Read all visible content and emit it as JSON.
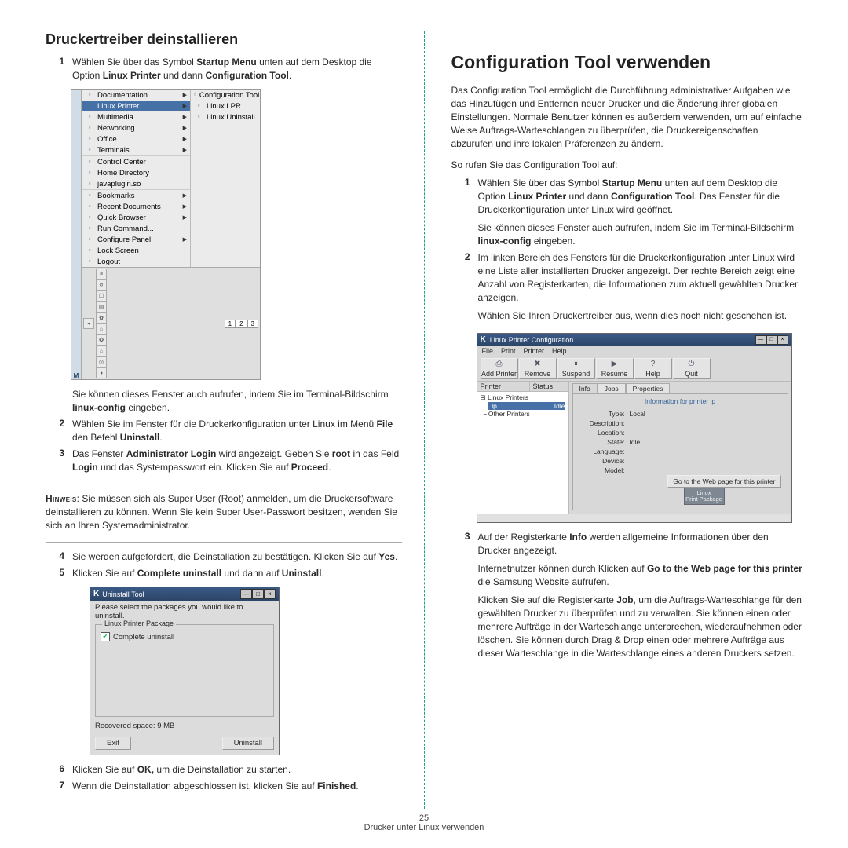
{
  "page_number": "25",
  "footer_line": "Drucker unter Linux verwenden",
  "left": {
    "heading": "Druckertreiber deinstallieren",
    "steps": [
      {
        "n": "1",
        "html": "Wählen Sie über das Symbol <strong>Startup Menu</strong> unten auf dem Desktop die Option <strong>Linux Printer</strong> und dann <strong>Configuration Tool</strong>."
      },
      {
        "text_after_fig1a": "Sie können dieses Fenster auch aufrufen, indem Sie im Terminal-Bildschirm <strong>linux-config</strong> eingeben."
      },
      {
        "n": "2",
        "html": "Wählen Sie im Fenster für die Druckerkonfiguration unter Linux im Menü <strong>File</strong> den Befehl <strong>Uninstall</strong>."
      },
      {
        "n": "3",
        "html": "Das Fenster <strong>Administrator Login</strong> wird angezeigt. Geben Sie <strong>root</strong> in das Feld <strong>Login</strong> und das Systempasswort ein. Klicken Sie auf <strong>Proceed</strong>."
      }
    ],
    "note_label": "Hinweis",
    "note_text": "Sie müssen sich als Super User (Root) anmelden, um die Druckersoftware deinstallieren zu können. Wenn Sie kein Super User-Passwort besitzen, wenden Sie sich an Ihren Systemadministrator.",
    "steps2": [
      {
        "n": "4",
        "html": "Sie werden aufgefordert, die Deinstallation zu bestätigen. Klicken Sie auf <strong>Yes</strong>."
      },
      {
        "n": "5",
        "html": "Klicken Sie auf <strong>Complete uninstall</strong> und dann auf <strong>Uninstall</strong>."
      }
    ],
    "steps3": [
      {
        "n": "6",
        "html": "Klicken Sie auf <strong>OK,</strong> um die Deinstallation zu starten."
      },
      {
        "n": "7",
        "html": "Wenn die Deinstallation abgeschlossen ist, klicken Sie auf <strong>Finished</strong>."
      }
    ],
    "fig_menu": {
      "left_letter": "M",
      "col1": [
        {
          "label": "Documentation",
          "arrow": true
        },
        {
          "label": "Linux Printer",
          "arrow": true,
          "selected": true
        },
        {
          "label": "Multimedia",
          "arrow": true
        },
        {
          "label": "Networking",
          "arrow": true
        },
        {
          "label": "Office",
          "arrow": true,
          "divider": true
        },
        {
          "label": "Terminals",
          "arrow": true,
          "divider_after": true
        },
        {
          "label": "Control Center"
        },
        {
          "label": "Home Directory"
        },
        {
          "label": "javaplugin.so",
          "divider_after": true
        },
        {
          "label": "Bookmarks",
          "arrow": true
        },
        {
          "label": "Recent Documents",
          "arrow": true
        },
        {
          "label": "Quick Browser",
          "arrow": true
        },
        {
          "label": "Run Command..."
        },
        {
          "label": "Configure Panel",
          "arrow": true,
          "divider_before": true
        },
        {
          "label": "Lock Screen"
        },
        {
          "label": "Logout"
        }
      ],
      "col2": [
        {
          "label": "Configuration Tool"
        },
        {
          "label": "Linux LPR"
        },
        {
          "label": "Linux Uninstall"
        }
      ],
      "taskbar_icons": [
        "≡",
        "↺",
        "☐",
        "▤",
        "✿",
        "⌂",
        "✪",
        "⌂",
        "◎",
        "◑"
      ],
      "taskbar_nums": [
        "1",
        "2",
        "3"
      ]
    },
    "fig_uninstall": {
      "title": "Uninstall Tool",
      "caption": "Please select the packages you would like to uninstall.",
      "legend": "Linux Printer Package",
      "option": "Complete uninstall",
      "status": "Recovered space: 9 MB",
      "btn_exit": "Exit",
      "btn_uninstall": "Uninstall"
    }
  },
  "right": {
    "heading": "Configuration Tool verwenden",
    "intro": "Das Configuration Tool ermöglicht die Durchführung administrativer Aufgaben wie das Hinzufügen und Entfernen neuer Drucker und die Änderung ihrer globalen Einstellungen. Normale Benutzer können es außerdem verwenden, um auf einfache Weise Auftrags-Warteschlangen zu überprüfen, die Druckereigenschaften abzurufen und ihre lokalen Präferenzen zu ändern.",
    "lead": "So rufen Sie das Configuration Tool auf:",
    "steps": [
      {
        "n": "1",
        "html": "Wählen Sie über das Symbol <strong>Startup Menu</strong> unten auf dem Desktop die Option <strong>Linux Printer</strong> und dann <strong>Configuration Tool</strong>. Das Fenster für die Druckerkonfiguration unter Linux wird geöffnet.",
        "p2": "Sie können dieses Fenster auch aufrufen, indem Sie im Terminal-Bildschirm <strong>linux-config</strong> eingeben."
      },
      {
        "n": "2",
        "html": "Im linken Bereich des Fensters für die Druckerkonfiguration unter Linux wird eine Liste aller installierten Drucker angezeigt. Der rechte Bereich zeigt eine Anzahl von Registerkarten, die Informationen zum aktuell gewählten Drucker anzeigen.",
        "p2": "Wählen Sie Ihren Druckertreiber aus, wenn dies noch nicht geschehen ist."
      }
    ],
    "steps2": [
      {
        "n": "3",
        "html": "Auf der Registerkarte <strong>Info</strong> werden allgemeine Informationen über den Drucker angezeigt.",
        "p2": "Internetnutzer können durch Klicken auf <strong>Go to the Web page for this printer</strong> die Samsung Website aufrufen.",
        "p3": "Klicken Sie auf die Registerkarte <strong>Job</strong>, um die Auftrags-Warteschlange für den gewählten Drucker zu überprüfen und zu verwalten. Sie können einen oder mehrere Aufträge in der Warteschlange unterbrechen, wiederaufnehmen oder löschen. Sie können durch Drag & Drop einen oder mehrere Aufträge aus dieser Warteschlange in die Warteschlange eines anderen Druckers setzen."
      }
    ],
    "fig_lpc": {
      "title": "Linux Printer Configuration",
      "menus": [
        "File",
        "Print",
        "Printer",
        "Help"
      ],
      "toolbar": [
        "Add Printer",
        "Remove",
        "Suspend",
        "Resume",
        "Help",
        "Quit"
      ],
      "left_headers": [
        "Printer",
        "Status"
      ],
      "tree": {
        "root": "Linux Printers",
        "sel_name": "lp",
        "sel_status": "Idle",
        "other": "Other Printers"
      },
      "tabs": [
        "Info",
        "Jobs",
        "Properties"
      ],
      "tab_title": "Information for printer lp",
      "rows": [
        {
          "lab": "Type:",
          "val": "Local"
        },
        {
          "lab": "Description:",
          "val": ""
        },
        {
          "lab": "Location:",
          "val": ""
        },
        {
          "lab": "State:",
          "val": "Idle"
        },
        {
          "lab": "Language:",
          "val": ""
        },
        {
          "lab": "Device:",
          "val": ""
        },
        {
          "lab": "Model:",
          "val": ""
        }
      ],
      "go_btn": "Go to the Web page for this printer",
      "badge_top": "Linux",
      "badge_bot": "Print Package"
    }
  }
}
